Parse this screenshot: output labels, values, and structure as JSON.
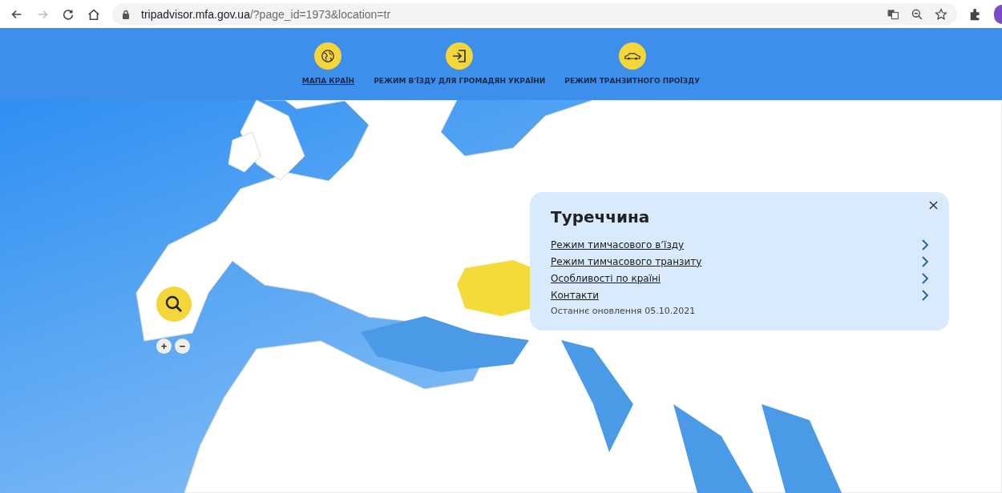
{
  "browser": {
    "url_host": "tripadvisor.mfa.gov.ua",
    "url_path": "/?page_id=1973&location=tr"
  },
  "nav": [
    {
      "label": "МАПА КРАЇН",
      "kind": "globe",
      "selected": true
    },
    {
      "label": "РЕЖИМ В'ЇЗДУ ДЛЯ ГРОМАДЯН УКРАЇНИ",
      "kind": "enter",
      "selected": false
    },
    {
      "label": "РЕЖИМ ТРАНЗИТНОГО ПРОЇЗДУ",
      "kind": "car",
      "selected": false
    }
  ],
  "map_controls": {
    "zoom_in": "+",
    "zoom_out": "−"
  },
  "popup": {
    "title": "Туреччина",
    "links": [
      "Режим тимчасового вʼїзду",
      "Режим тимчасового транзиту",
      "Особливості по країні",
      "Контакти"
    ],
    "updated": "Останнє оновлення 05.10.2021"
  }
}
